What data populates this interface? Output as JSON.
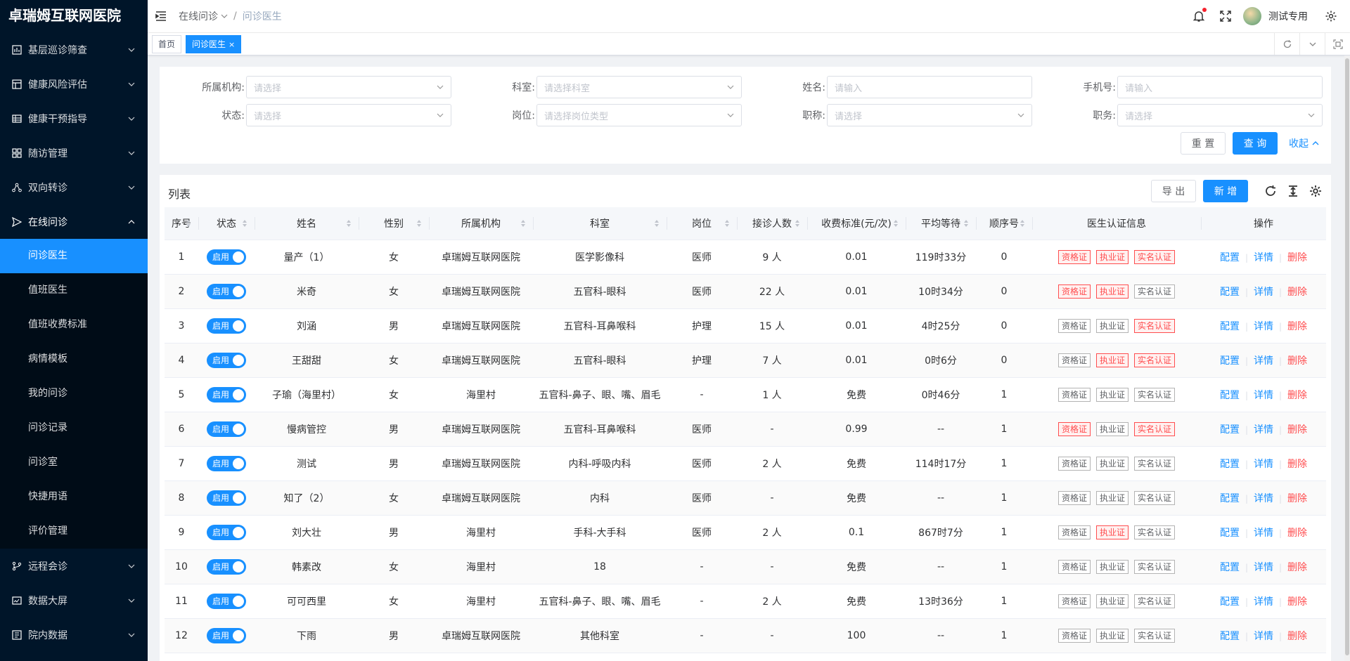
{
  "app": {
    "title": "卓瑞姆互联网医院"
  },
  "sidebar": {
    "items": [
      {
        "label": "基层巡诊筛查",
        "icon": "screening-icon"
      },
      {
        "label": "健康风险评估",
        "icon": "assessment-icon"
      },
      {
        "label": "健康干预指导",
        "icon": "guidance-icon"
      },
      {
        "label": "随访管理",
        "icon": "followup-icon"
      },
      {
        "label": "双向转诊",
        "icon": "referral-icon"
      },
      {
        "label": "在线问诊",
        "icon": "send-icon"
      },
      {
        "label": "远程会诊",
        "icon": "branch-icon"
      },
      {
        "label": "数据大屏",
        "icon": "dashboard-icon"
      },
      {
        "label": "院内数据",
        "icon": "data-icon"
      }
    ],
    "submenu": [
      {
        "label": "问诊医生",
        "active": true
      },
      {
        "label": "值班医生"
      },
      {
        "label": "值班收费标准"
      },
      {
        "label": "病情模板"
      },
      {
        "label": "我的问诊"
      },
      {
        "label": "问诊记录"
      },
      {
        "label": "问诊室"
      },
      {
        "label": "快捷用语"
      },
      {
        "label": "评价管理"
      }
    ]
  },
  "header": {
    "breadcrumb": [
      "在线问诊",
      "问诊医生"
    ],
    "username": "测试专用"
  },
  "tabs": [
    {
      "label": "首页",
      "active": false
    },
    {
      "label": "问诊医生",
      "active": true,
      "close": "×"
    }
  ],
  "filters": {
    "org_label": "所属机构:",
    "org_placeholder": "请选择",
    "dept_label": "科室:",
    "dept_placeholder": "请选择科室",
    "name_label": "姓名:",
    "name_placeholder": "请输入",
    "phone_label": "手机号:",
    "phone_placeholder": "请输入",
    "status_label": "状态:",
    "status_placeholder": "请选择",
    "post_label": "岗位:",
    "post_placeholder": "请选择岗位类型",
    "title_label": "职称:",
    "title_placeholder": "请选择",
    "duty_label": "职务:",
    "duty_placeholder": "请选择",
    "reset": "重 置",
    "search": "查 询",
    "collapse": "收起"
  },
  "list": {
    "title": "列表",
    "export": "导 出",
    "add": "新 增",
    "columns": [
      "序号",
      "状态",
      "姓名",
      "性别",
      "所属机构",
      "科室",
      "岗位",
      "接诊人数",
      "收费标准(元/次)",
      "平均等待",
      "顺序号",
      "医生认证信息",
      "操作"
    ],
    "switch_label": "启用",
    "cert_labels": [
      "资格证",
      "执业证",
      "实名认证"
    ],
    "actions": [
      "配置",
      "详情",
      "删除"
    ],
    "rows": [
      {
        "no": "1",
        "name": "量产（1）",
        "gender": "女",
        "org": "卓瑞姆互联网医院",
        "dept": "医学影像科",
        "post": "医师",
        "visits": "9 人",
        "fee": "0.01",
        "wait": "119时33分",
        "order": "0",
        "certs": [
          true,
          true,
          true
        ]
      },
      {
        "no": "2",
        "name": "米奇",
        "gender": "女",
        "org": "卓瑞姆互联网医院",
        "dept": "五官科-眼科",
        "post": "医师",
        "visits": "22 人",
        "fee": "0.01",
        "wait": "10时34分",
        "order": "0",
        "certs": [
          true,
          true,
          false
        ]
      },
      {
        "no": "3",
        "name": "刘涵",
        "gender": "男",
        "org": "卓瑞姆互联网医院",
        "dept": "五官科-耳鼻喉科",
        "post": "护理",
        "visits": "15 人",
        "fee": "0.01",
        "wait": "4时25分",
        "order": "0",
        "certs": [
          false,
          false,
          true
        ]
      },
      {
        "no": "4",
        "name": "王甜甜",
        "gender": "女",
        "org": "卓瑞姆互联网医院",
        "dept": "五官科-眼科",
        "post": "护理",
        "visits": "7 人",
        "fee": "0.01",
        "wait": "0时6分",
        "order": "0",
        "certs": [
          false,
          true,
          true
        ]
      },
      {
        "no": "5",
        "name": "子瑜（海里村）",
        "gender": "女",
        "org": "海里村",
        "dept": "五官科-鼻子、眼、嘴、眉毛",
        "post": "-",
        "visits": "1 人",
        "fee": "免费",
        "wait": "0时46分",
        "order": "1",
        "certs": [
          false,
          false,
          false
        ]
      },
      {
        "no": "6",
        "name": "慢病管控",
        "gender": "男",
        "org": "卓瑞姆互联网医院",
        "dept": "五官科-耳鼻喉科",
        "post": "医师",
        "visits": "-",
        "fee": "0.99",
        "wait": "--",
        "order": "1",
        "certs": [
          true,
          false,
          true
        ]
      },
      {
        "no": "7",
        "name": "测试",
        "gender": "男",
        "org": "卓瑞姆互联网医院",
        "dept": "内科-呼吸内科",
        "post": "医师",
        "visits": "2 人",
        "fee": "免费",
        "wait": "114时17分",
        "order": "1",
        "certs": [
          false,
          false,
          false
        ]
      },
      {
        "no": "8",
        "name": "知了（2）",
        "gender": "女",
        "org": "卓瑞姆互联网医院",
        "dept": "内科",
        "post": "医师",
        "visits": "-",
        "fee": "免费",
        "wait": "--",
        "order": "1",
        "certs": [
          false,
          false,
          false
        ]
      },
      {
        "no": "9",
        "name": "刘大壮",
        "gender": "男",
        "org": "海里村",
        "dept": "手科-大手科",
        "post": "医师",
        "visits": "2 人",
        "fee": "0.1",
        "wait": "867时7分",
        "order": "1",
        "certs": [
          false,
          true,
          false
        ]
      },
      {
        "no": "10",
        "name": "韩素改",
        "gender": "女",
        "org": "海里村",
        "dept": "18",
        "post": "-",
        "visits": "-",
        "fee": "免费",
        "wait": "--",
        "order": "1",
        "certs": [
          false,
          false,
          false
        ]
      },
      {
        "no": "11",
        "name": "可可西里",
        "gender": "女",
        "org": "海里村",
        "dept": "五官科-鼻子、眼、嘴、眉毛",
        "post": "-",
        "visits": "2 人",
        "fee": "免费",
        "wait": "13时36分",
        "order": "1",
        "certs": [
          false,
          false,
          false
        ]
      },
      {
        "no": "12",
        "name": "下雨",
        "gender": "男",
        "org": "卓瑞姆互联网医院",
        "dept": "其他科室",
        "post": "-",
        "visits": "-",
        "fee": "100",
        "wait": "--",
        "order": "1",
        "certs": [
          false,
          false,
          false
        ]
      }
    ]
  },
  "colors": {
    "primary": "#1890ff",
    "sidebar": "#001529",
    "danger": "#ff4d4f"
  }
}
